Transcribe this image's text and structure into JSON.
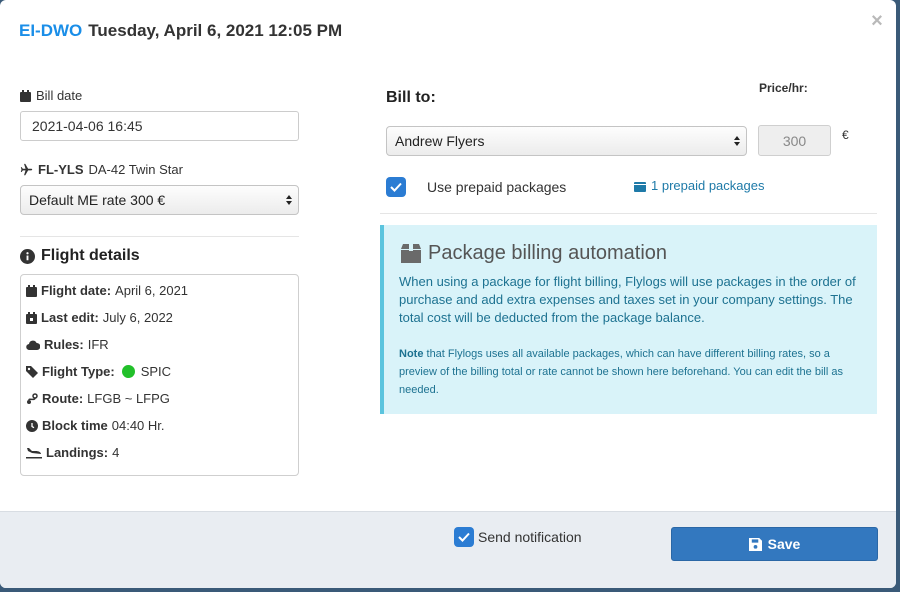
{
  "header": {
    "tail_number": "EI-DWO",
    "datetime": "Tuesday, April 6, 2021 12:05 PM"
  },
  "bill_date": {
    "label": "Bill date",
    "value": "2021-04-06 16:45"
  },
  "aircraft": {
    "registration": "FL-YLS",
    "model": "DA-42 Twin Star",
    "rate_selected": "Default ME rate 300 €"
  },
  "flight_details": {
    "heading": "Flight details",
    "rows": [
      {
        "label": "Flight date:",
        "value": "April 6, 2021",
        "icon": "calendar-icon"
      },
      {
        "label": "Last edit:",
        "value": "July 6, 2022",
        "icon": "calendar-edit-icon"
      },
      {
        "label": "Rules:",
        "value": "IFR",
        "icon": "cloud-icon"
      },
      {
        "label": "Flight Type:",
        "value": "SPIC",
        "icon": "tag-icon"
      },
      {
        "label": "Route:",
        "value": "LFGB ~ LFPG",
        "icon": "route-icon"
      },
      {
        "label": "Block time",
        "value": "04:40 Hr.",
        "icon": "clock-icon"
      },
      {
        "label": "Landings:",
        "value": "4",
        "icon": "plane-landing-icon"
      }
    ]
  },
  "bill_to": {
    "label": "Bill to:",
    "price_label": "Price/hr:",
    "customer_selected": "Andrew Flyers",
    "price_value": "300",
    "currency": "€",
    "use_prepaid_label": "Use prepaid packages",
    "use_prepaid_checked": true,
    "prepaid_link": "1 prepaid packages"
  },
  "info": {
    "heading": "Package billing automation",
    "body": "When using a package for flight billing, Flylogs will use packages in the order of purchase and add extra expenses and taxes set in your company settings. The total cost will be deducted from the package balance.",
    "note_bold": "Note",
    "note_text": " that Flylogs uses all available packages, which can have different billing rates, so a preview of the billing total or rate cannot be shown here beforehand. You can edit the bill as needed."
  },
  "footer": {
    "send_notification_label": "Send notification",
    "send_notification_checked": true,
    "save_label": "Save"
  },
  "colors": {
    "accent": "#1a8ee8",
    "primary_button": "#3378bf",
    "info_bg": "#d9f3f9",
    "info_border": "#5bc4de",
    "link": "#1e7aa8",
    "status_green": "#22c02a"
  }
}
